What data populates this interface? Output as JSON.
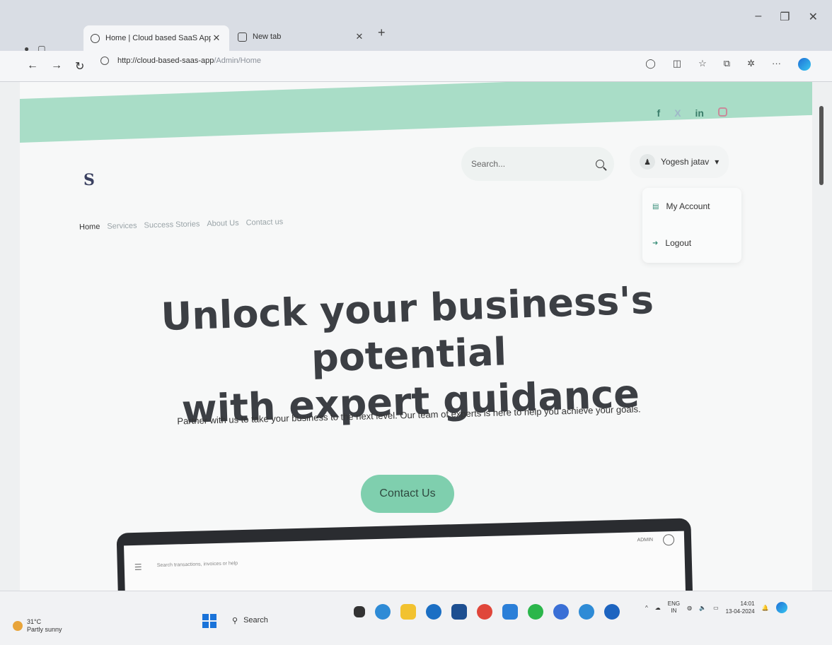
{
  "browser": {
    "tabs": [
      {
        "label": "Home | Cloud based SaaS App",
        "active": true
      },
      {
        "label": "New tab",
        "active": false
      }
    ],
    "url_host": "http://cloud-based-saas-app",
    "url_path": "/Admin/Home"
  },
  "site": {
    "social": [
      "f",
      "X",
      "in"
    ],
    "logo": "S",
    "search_placeholder": "Search...",
    "user_name": "Yogesh jatav",
    "user_menu": [
      "My Account",
      "Logout"
    ],
    "nav": [
      "Home",
      "Services",
      "Success Stories",
      "About Us",
      "Contact us"
    ],
    "hero_title_line1": "Unlock your business's potential",
    "hero_title_line2": "with expert guidance",
    "hero_subtitle": "Partner with us to take your business to the next level. Our team of experts is here to help you achieve your goals.",
    "cta_label": "Contact Us",
    "device_search": "Search transactions, invoices or help",
    "device_admin": "ADMIN"
  },
  "taskbar": {
    "weather_temp": "31°C",
    "weather_text": "Partly sunny",
    "search_label": "Search",
    "lang_line1": "ENG",
    "lang_line2": "IN",
    "time": "14:01",
    "date": "13-04-2024"
  },
  "colors": {
    "accent": "#a9ddc7",
    "cta": "#7fcfae",
    "heading": "#3c3f44"
  }
}
